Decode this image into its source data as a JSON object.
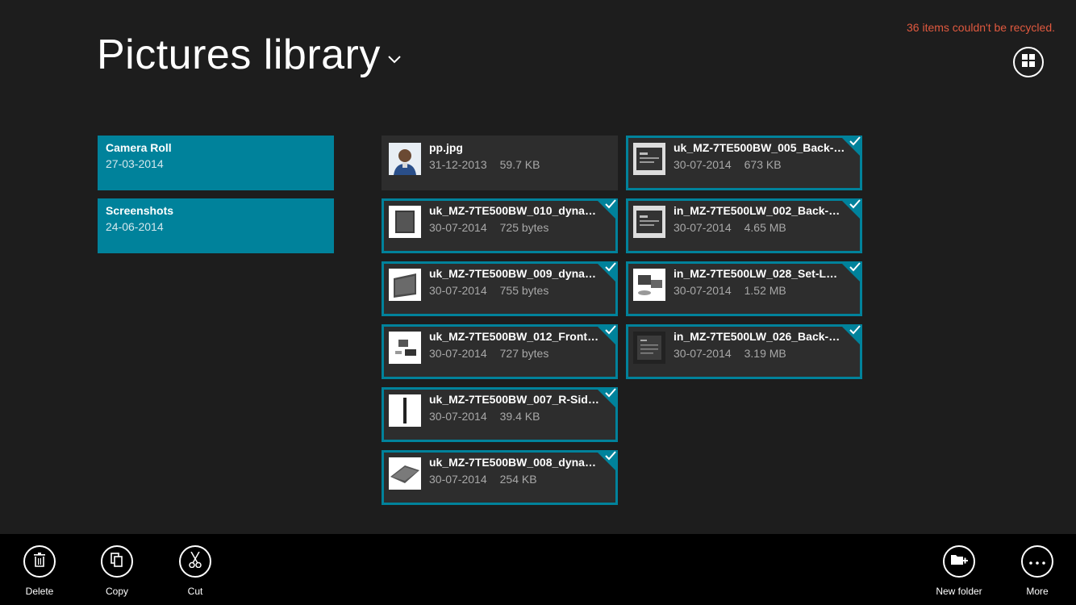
{
  "status_message": "36 items couldn't be recycled.",
  "header": {
    "title": "Pictures library",
    "title_dropdown_icon": "chevron-down-icon",
    "view_toggle_icon": "grid-view-icon"
  },
  "colors": {
    "background": "#1d1d1d",
    "accent": "#00829b",
    "tile": "#2d2d2d",
    "app_bar": "#000000",
    "error": "#e0593f"
  },
  "folders": [
    {
      "name": "Camera Roll",
      "date": "27-03-2014"
    },
    {
      "name": "Screenshots",
      "date": "24-06-2014"
    }
  ],
  "files": [
    {
      "name": "pp.jpg",
      "date": "31-12-2013",
      "size": "59.7 KB",
      "selected": false,
      "thumb": "person-photo"
    },
    {
      "name": "uk_MZ-7TE500BW_010_dynamic...",
      "date": "30-07-2014",
      "size": "725 bytes",
      "selected": true,
      "thumb": "ssd-front"
    },
    {
      "name": "uk_MZ-7TE500BW_009_dynamic...",
      "date": "30-07-2014",
      "size": "755 bytes",
      "selected": true,
      "thumb": "ssd-front"
    },
    {
      "name": "uk_MZ-7TE500BW_012_Front_gr...",
      "date": "30-07-2014",
      "size": "727 bytes",
      "selected": true,
      "thumb": "ssd-small"
    },
    {
      "name": "uk_MZ-7TE500BW_007_R-Side_g...",
      "date": "30-07-2014",
      "size": "39.4 KB",
      "selected": true,
      "thumb": "ssd-side"
    },
    {
      "name": "uk_MZ-7TE500BW_008_dynamic...",
      "date": "30-07-2014",
      "size": "254 KB",
      "selected": true,
      "thumb": "ssd-angle"
    },
    {
      "name": "uk_MZ-7TE500BW_005_Back-50...",
      "date": "30-07-2014",
      "size": "673 KB",
      "selected": true,
      "thumb": "ssd-back"
    },
    {
      "name": "in_MZ-7TE500LW_002_Back-500...",
      "date": "30-07-2014",
      "size": "4.65 MB",
      "selected": true,
      "thumb": "ssd-back"
    },
    {
      "name": "in_MZ-7TE500LW_028_Set-LAPT...",
      "date": "30-07-2014",
      "size": "1.52 MB",
      "selected": true,
      "thumb": "ssd-kit"
    },
    {
      "name": "in_MZ-7TE500LW_026_Back-LAP...",
      "date": "30-07-2014",
      "size": "3.19 MB",
      "selected": true,
      "thumb": "ssd-back-dark"
    }
  ],
  "app_bar": {
    "left": [
      {
        "label": "Delete",
        "icon": "trash-icon"
      },
      {
        "label": "Copy",
        "icon": "copy-icon"
      },
      {
        "label": "Cut",
        "icon": "scissors-icon"
      }
    ],
    "right": [
      {
        "label": "New folder",
        "icon": "new-folder-icon"
      },
      {
        "label": "More",
        "icon": "more-icon"
      }
    ]
  }
}
